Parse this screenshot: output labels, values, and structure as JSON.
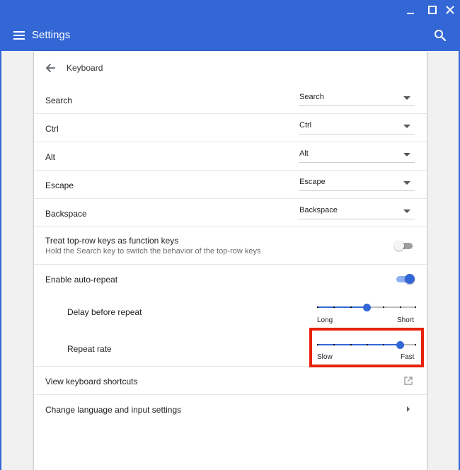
{
  "header": {
    "title": "Settings"
  },
  "page": {
    "title": "Keyboard"
  },
  "key_mappings": [
    {
      "label": "Search",
      "value": "Search"
    },
    {
      "label": "Ctrl",
      "value": "Ctrl"
    },
    {
      "label": "Alt",
      "value": "Alt"
    },
    {
      "label": "Escape",
      "value": "Escape"
    },
    {
      "label": "Backspace",
      "value": "Backspace"
    }
  ],
  "function_keys": {
    "label": "Treat top-row keys as function keys",
    "description": "Hold the Search key to switch the behavior of the top-row keys",
    "enabled": false
  },
  "auto_repeat": {
    "label": "Enable auto-repeat",
    "enabled": true
  },
  "delay": {
    "label": "Delay before repeat",
    "min_label": "Long",
    "max_label": "Short",
    "steps": 7,
    "value_step": 3
  },
  "rate": {
    "label": "Repeat rate",
    "min_label": "Slow",
    "max_label": "Fast",
    "steps": 7,
    "value_step": 5
  },
  "shortcuts": {
    "label": "View keyboard shortcuts"
  },
  "language": {
    "label": "Change language and input settings"
  },
  "colors": {
    "accent": "#3367d6",
    "highlight": "#e8210b",
    "toggle_off_track": "#9e9e9e"
  }
}
